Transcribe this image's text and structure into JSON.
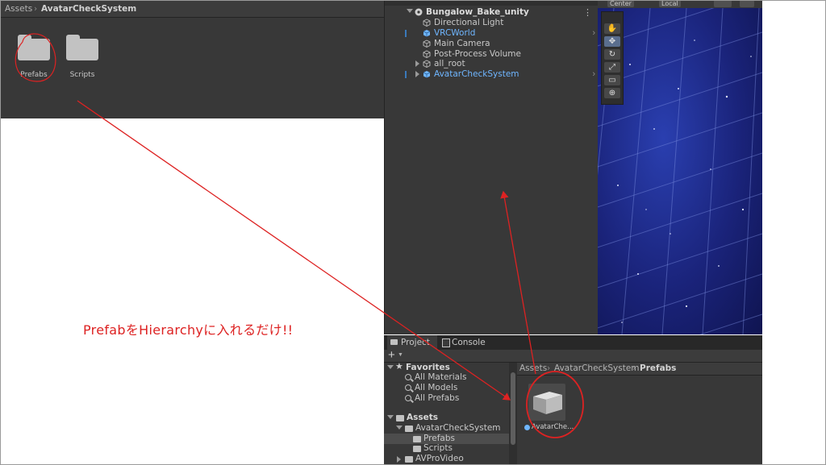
{
  "top_project": {
    "breadcrumb": [
      "Assets",
      "AvatarCheckSystem"
    ],
    "folders": [
      {
        "label": "Prefabs"
      },
      {
        "label": "Scripts"
      }
    ]
  },
  "hierarchy": {
    "scene_name": "Bungalow_Bake_unity",
    "menu_icon": "⋮",
    "items": [
      {
        "label": "Directional Light"
      },
      {
        "label": "VRCWorld"
      },
      {
        "label": "Main Camera"
      },
      {
        "label": "Post-Process Volume"
      },
      {
        "label": "all_root"
      },
      {
        "label": "AvatarCheckSystem"
      }
    ]
  },
  "scene_view": {
    "pivot_label": "Center",
    "space_label": "Local"
  },
  "project_window": {
    "tabs": [
      {
        "label": "Project"
      },
      {
        "label": "Console"
      }
    ],
    "add_label": "+",
    "favorites": {
      "label": "Favorites",
      "items": [
        {
          "label": "All Materials"
        },
        {
          "label": "All Models"
        },
        {
          "label": "All Prefabs"
        }
      ]
    },
    "assets": {
      "label": "Assets",
      "items": [
        {
          "label": "AvatarCheckSystem"
        },
        {
          "label": "Prefabs"
        },
        {
          "label": "Scripts"
        },
        {
          "label": "AVProVideo"
        }
      ]
    },
    "breadcrumb": [
      "Assets",
      "AvatarCheckSystem",
      "Prefabs"
    ],
    "asset": {
      "label": "AvatarChe..."
    }
  },
  "annotation": {
    "text": "PrefabをHierarchyに入れるだけ!!",
    "color": "#dd2222"
  }
}
